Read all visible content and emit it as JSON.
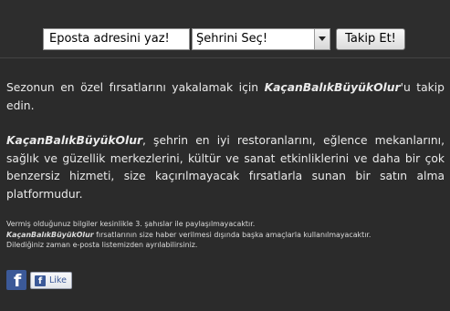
{
  "form": {
    "email_value": "Eposta adresini yaz!",
    "city_selected": "Şehrini Seç!",
    "follow_label": "Takip Et!"
  },
  "intro": {
    "before": "Sezonun en özel fırsatlarını yakalamak için ",
    "brand": "KaçanBalıkBüyükOlur",
    "after": "'u takip edin."
  },
  "description": {
    "brand": "KaçanBalıkBüyükOlur",
    "text": ", şehrin en iyi restoranlarını, eğlence mekanlarını, sağlık ve güzellik merkezlerini, kültür ve sanat etkinliklerini ve daha bir çok benzersiz hizmeti, size kaçırılmayacak fırsatlarla sunan bir satın alma platformudur."
  },
  "privacy": {
    "line1": "Vermiş olduğunuz bilgiler kesinlikle 3. şahıslar ile paylaşılmayacaktır.",
    "brand": "KaçanBalıkBüyükOlur",
    "line2_rest": " fırsatlarının size haber verilmesi dışında başka amaçlarla kullanılmayacaktır.",
    "line3": "Dilediğiniz zaman e-posta listemizden ayrılabilirsiniz."
  },
  "social": {
    "fb_icon_glyph": "f",
    "like_glyph": "f",
    "like_label": "Like"
  },
  "colors": {
    "background": "#2b2b2b",
    "facebook_blue": "#3b5998"
  }
}
